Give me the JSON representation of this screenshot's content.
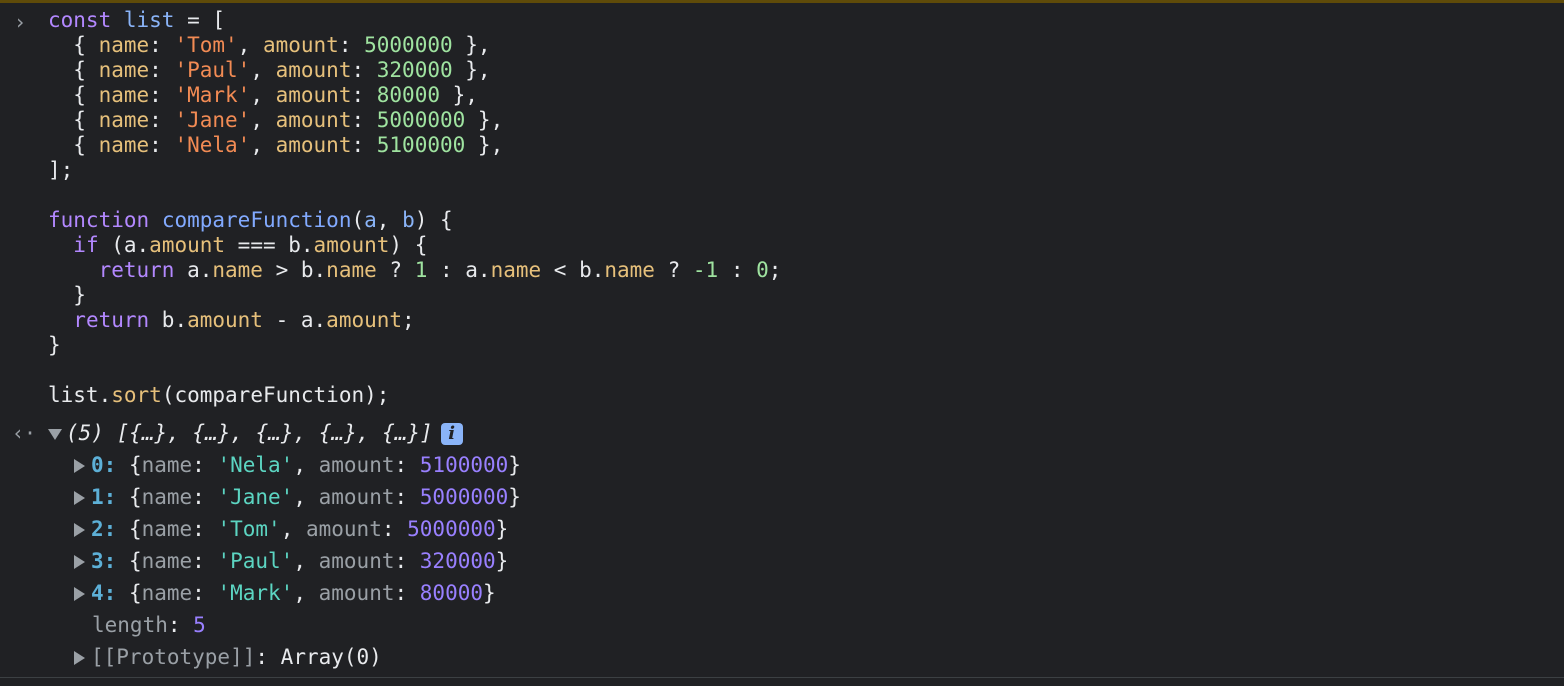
{
  "code": {
    "line1": {
      "k": "const",
      "v": "list",
      "rest": " = ["
    },
    "items": [
      {
        "name": "'Tom'",
        "amount": "5000000"
      },
      {
        "name": "'Paul'",
        "amount": "320000"
      },
      {
        "name": "'Mark'",
        "amount": "80000"
      },
      {
        "name": "'Jane'",
        "amount": "5000000"
      },
      {
        "name": "'Nela'",
        "amount": "5100000"
      }
    ],
    "close": "];",
    "fn_kw": "function",
    "fn_name": "compareFunction",
    "p_a": "a",
    "p_b": "b",
    "if_kw": "if",
    "return_kw": "return",
    "prop_name": "name",
    "prop_amount": "amount",
    "num_1": "1",
    "num_neg1": "-1",
    "num_0": "0",
    "sort_obj": "list",
    "sort_method": "sort",
    "sort_arg": "(compareFunction);"
  },
  "result": {
    "summary": "(5) [{…}, {…}, {…}, {…}, {…}]",
    "info": "i",
    "entries": [
      {
        "idx": "0:",
        "name": "'Nela'",
        "amount": "5100000"
      },
      {
        "idx": "1:",
        "name": "'Jane'",
        "amount": "5000000"
      },
      {
        "idx": "2:",
        "name": "'Tom'",
        "amount": "5000000"
      },
      {
        "idx": "3:",
        "name": "'Paul'",
        "amount": "320000"
      },
      {
        "idx": "4:",
        "name": "'Mark'",
        "amount": "80000"
      }
    ],
    "length_key": "length",
    "length_val": "5",
    "proto_key": "[[Prototype]]",
    "proto_val": "Array(0)"
  }
}
